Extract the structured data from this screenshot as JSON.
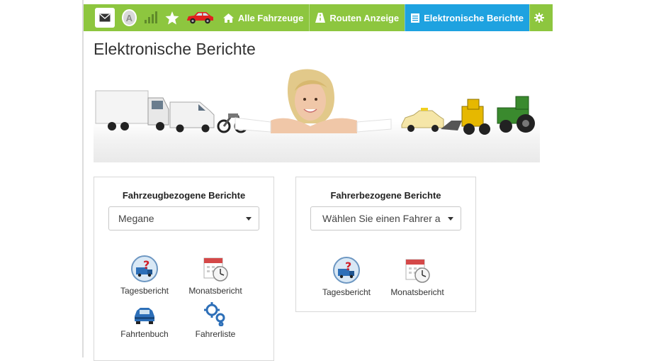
{
  "nav": {
    "badge_letter": "A",
    "tabs": [
      {
        "label": "Alle Fahrzeuge",
        "icon": "home-icon"
      },
      {
        "label": "Routen Anzeige",
        "icon": "road-icon"
      },
      {
        "label": "Elektronische Berichte",
        "icon": "report-icon",
        "active": true
      }
    ],
    "colors": {
      "bar": "#8dc63f",
      "active": "#1ea2e0"
    }
  },
  "page": {
    "title": "Elektronische Berichte"
  },
  "vehicle_panel": {
    "title": "Fahrzeugbezogene Berichte",
    "select_value": "Megane",
    "tiles": [
      {
        "label": "Tagesbericht",
        "icon": "truck-question-icon"
      },
      {
        "label": "Monatsbericht",
        "icon": "calendar-clock-icon"
      },
      {
        "label": "Fahrtenbuch",
        "icon": "car-book-icon"
      },
      {
        "label": "Fahrerliste",
        "icon": "gears-icon"
      }
    ]
  },
  "driver_panel": {
    "title": "Fahrerbezogene Berichte",
    "select_value": "Wählen Sie einen Fahrer a",
    "tiles": [
      {
        "label": "Tagesbericht",
        "icon": "truck-question-icon"
      },
      {
        "label": "Monatsbericht",
        "icon": "calendar-clock-icon"
      }
    ]
  }
}
